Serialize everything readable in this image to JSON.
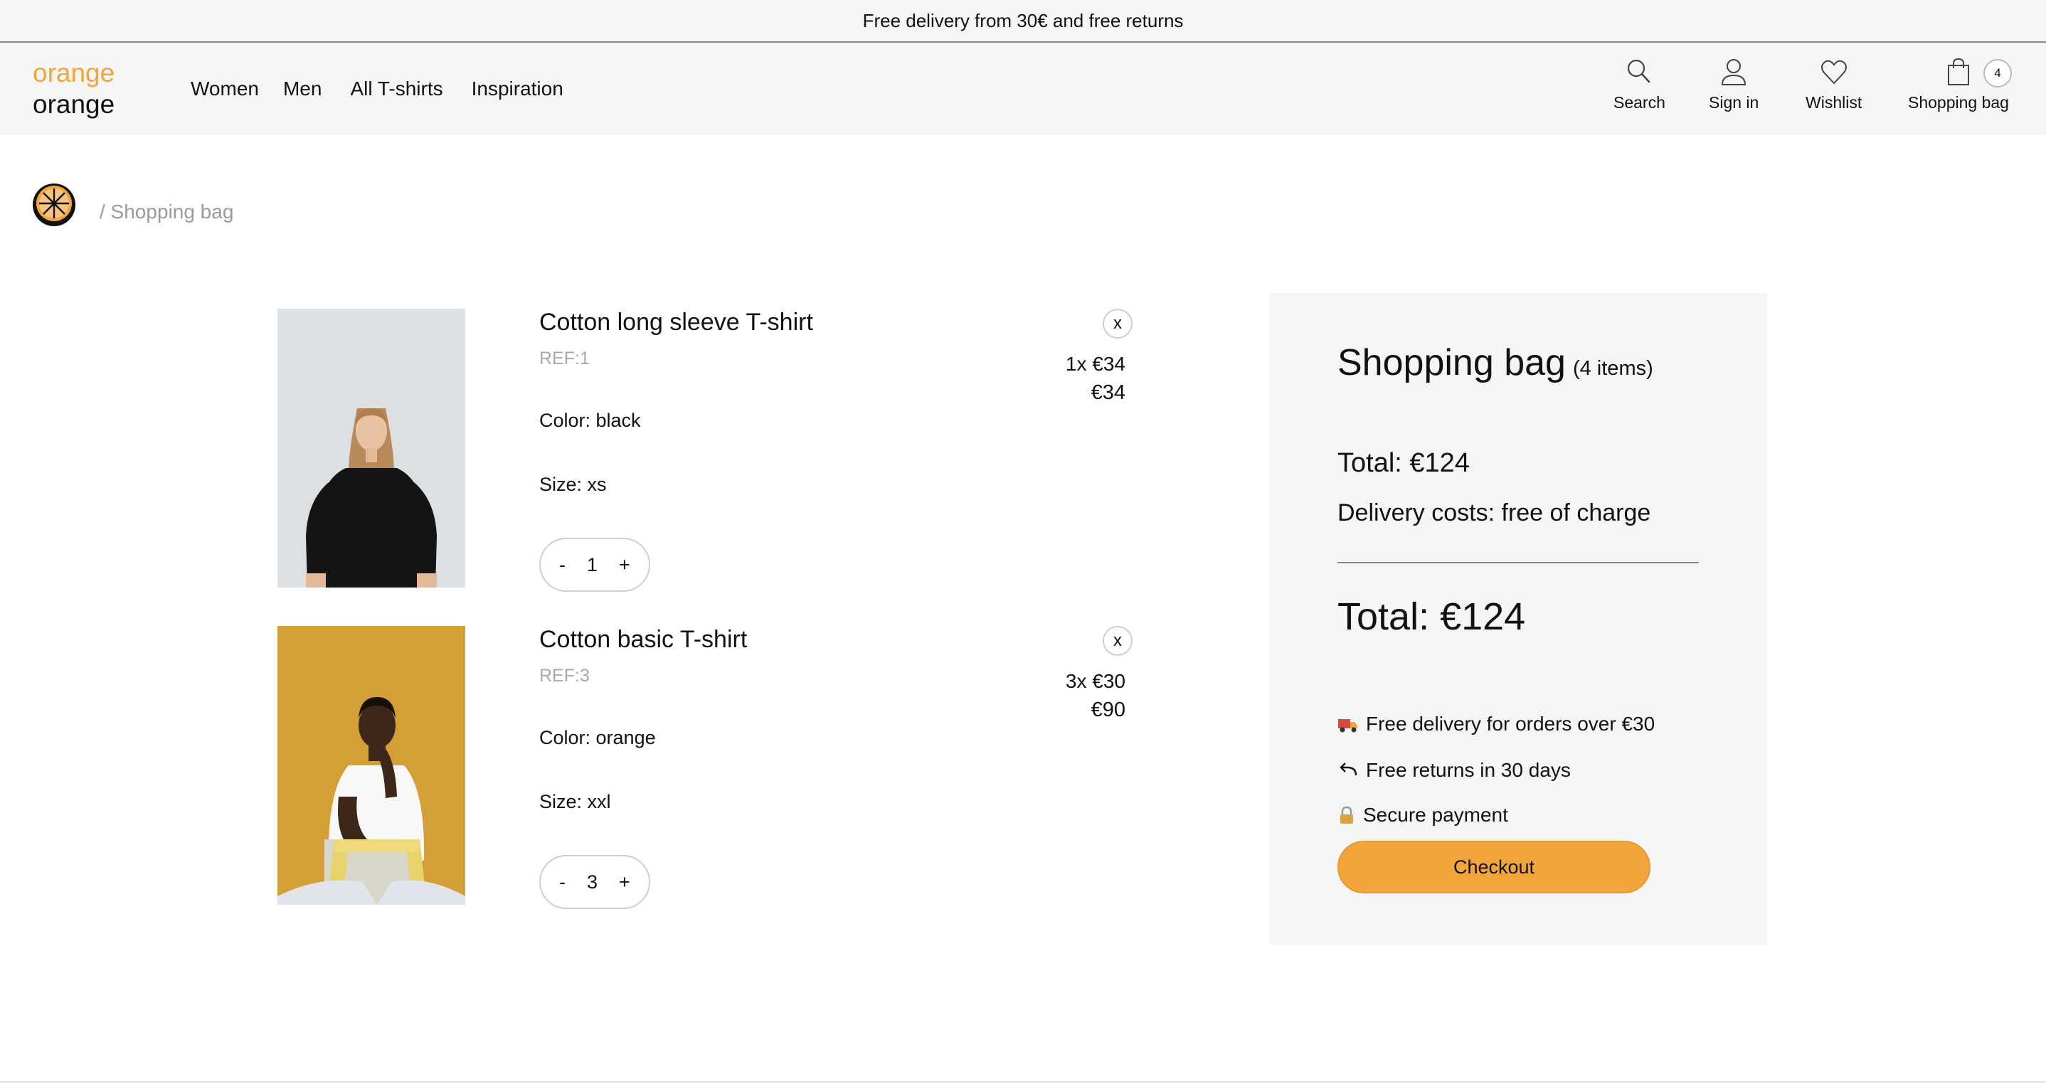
{
  "announcement": "Free delivery from 30€ and free returns",
  "brand": {
    "line1": "orange",
    "line2": "orange",
    "accent": "#f2a53b"
  },
  "nav": [
    "Women",
    "Men",
    "All T-shirts",
    "Inspiration"
  ],
  "header_actions": {
    "search": "Search",
    "signin": "Sign in",
    "wishlist": "Wishlist",
    "bag": "Shopping bag",
    "bag_count": "4"
  },
  "breadcrumb": "/ Shopping bag",
  "items": [
    {
      "name": "Cotton long sleeve T-shirt",
      "ref": "REF:1",
      "color": "Color: black",
      "size": "Size: xs",
      "qty": "1",
      "minus": "-",
      "plus": "+",
      "remove": "x",
      "unit": "1x €34",
      "line_total": "€34"
    },
    {
      "name": "Cotton basic T-shirt",
      "ref": "REF:3",
      "color": "Color: orange",
      "size": "Size: xxl",
      "qty": "3",
      "minus": "-",
      "plus": "+",
      "remove": "x",
      "unit": "3x €30",
      "line_total": "€90"
    }
  ],
  "summary": {
    "title": "Shopping bag",
    "count": "(4 items)",
    "total_small": "Total: €124",
    "delivery": "Delivery costs: free of charge",
    "total_big": "Total: €124",
    "perks": [
      "Free delivery for orders over €30",
      "Free returns in 30 days",
      "Secure payment"
    ],
    "checkout": "Checkout"
  }
}
